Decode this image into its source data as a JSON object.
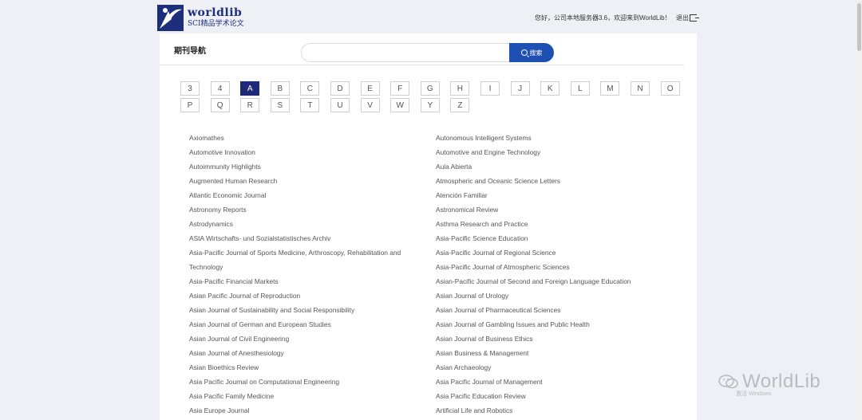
{
  "header": {
    "logo_name": "worldlib",
    "logo_sub": "SCI精品学术论文",
    "greeting": "您好，公司本地服务器3.6，欢迎来到WorldLib！",
    "logout_label": "退出"
  },
  "page_title": "期刊导航",
  "search": {
    "value": "",
    "placeholder": "",
    "button_label": "搜索"
  },
  "letters": [
    "3",
    "4",
    "A",
    "B",
    "C",
    "D",
    "E",
    "F",
    "G",
    "H",
    "I",
    "J",
    "K",
    "L",
    "M",
    "N",
    "O",
    "P",
    "Q",
    "R",
    "S",
    "T",
    "U",
    "V",
    "W",
    "Y",
    "Z"
  ],
  "active_letter": "A",
  "journals_left": [
    "Axiomathes",
    "Automotive Innovation",
    "Autoimmunity Highlights",
    "Augmented Human Research",
    "Atlantic Economic Journal",
    "Astronomy Reports",
    "Astrodynamics",
    "AStA Wirtschafts- und Sozialstatistisches Archiv",
    "Asia-Pacific Journal of Sports Medicine, Arthroscopy, Rehabilitation and",
    "Technology",
    "Asia-Pacific Financial Markets",
    "Asian Pacific Journal of Reproduction",
    "Asian Journal of Sustainability and Social Responsibility",
    "Asian Journal of German and European Studies",
    "Asian Journal of Civil Engineering",
    "Asian Journal of Anesthesiology",
    "Asian Bioethics Review",
    "Asia Pacific Journal on Computational Engineering",
    "Asia Pacific Family Medicine",
    "Asia Europe Journal"
  ],
  "journals_right": [
    "Autonomous Intelligent Systems",
    "Automotive and Engine Technology",
    "Aula Abierta",
    "Atmospheric and Oceanic Science Letters",
    "Atención Familiar",
    "Astronomical Review",
    "Asthma Research and Practice",
    "Asia-Pacific Science Education",
    "Asia-Pacific Journal of Regional Science",
    "Asia-Pacific Journal of Atmospheric Sciences",
    "Asian-Pacific Journal of Second and Foreign Language Education",
    "Asian Journal of Urology",
    "Asian Journal of Pharmaceutical Sciences",
    "Asian Journal of Gambling Issues and Public Health",
    "Asian Journal of Business Ethics",
    "Asian Business & Management",
    "Asian Archaeology",
    "Asia Pacific Journal of Management",
    "Asia Pacific Education Review",
    "Artificial Life and Robotics"
  ],
  "watermark": {
    "text": "WorldLib",
    "sub": "激活 Windows"
  },
  "colors": {
    "brand": "#1d2f7a",
    "search_button": "#1e4fb3",
    "active_letter": "#1d2a78"
  }
}
